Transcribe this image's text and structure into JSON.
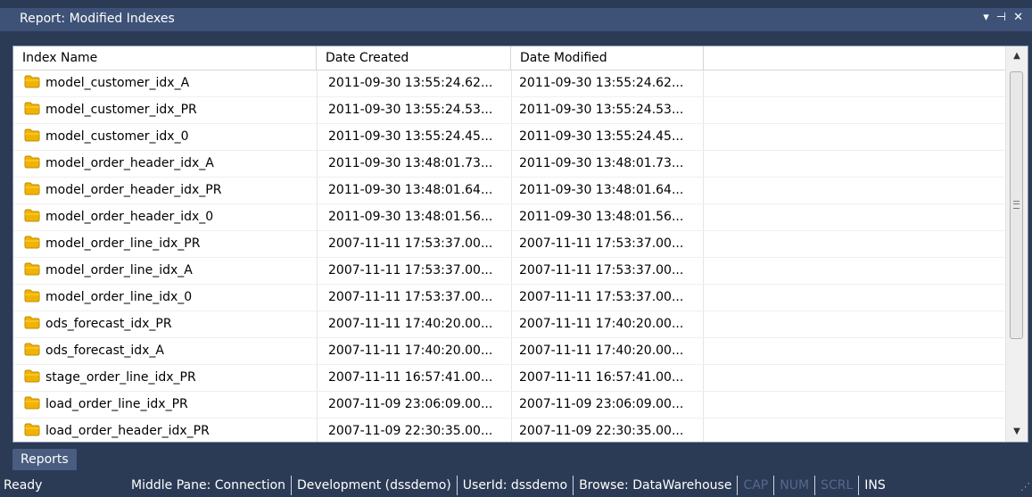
{
  "panel": {
    "title": "Report: Modified Indexes",
    "pin_icon": "pin-icon",
    "dropdown_icon": "chevron-down-icon",
    "close_icon": "close-icon"
  },
  "grid": {
    "columns": [
      "Index Name",
      "Date Created",
      "Date Modified"
    ],
    "row_icon": "folder-icon",
    "rows": [
      {
        "name": "model_customer_idx_A",
        "created": "2011-09-30 13:55:24.62...",
        "modified": "2011-09-30 13:55:24.62..."
      },
      {
        "name": "model_customer_idx_PR",
        "created": "2011-09-30 13:55:24.53...",
        "modified": "2011-09-30 13:55:24.53..."
      },
      {
        "name": "model_customer_idx_0",
        "created": "2011-09-30 13:55:24.45...",
        "modified": "2011-09-30 13:55:24.45..."
      },
      {
        "name": "model_order_header_idx_A",
        "created": "2011-09-30 13:48:01.73...",
        "modified": "2011-09-30 13:48:01.73..."
      },
      {
        "name": "model_order_header_idx_PR",
        "created": "2011-09-30 13:48:01.64...",
        "modified": "2011-09-30 13:48:01.64..."
      },
      {
        "name": "model_order_header_idx_0",
        "created": "2011-09-30 13:48:01.56...",
        "modified": "2011-09-30 13:48:01.56..."
      },
      {
        "name": "model_order_line_idx_PR",
        "created": "2007-11-11 17:53:37.00...",
        "modified": "2007-11-11 17:53:37.00..."
      },
      {
        "name": "model_order_line_idx_A",
        "created": "2007-11-11 17:53:37.00...",
        "modified": "2007-11-11 17:53:37.00..."
      },
      {
        "name": "model_order_line_idx_0",
        "created": "2007-11-11 17:53:37.00...",
        "modified": "2007-11-11 17:53:37.00..."
      },
      {
        "name": "ods_forecast_idx_PR",
        "created": "2007-11-11 17:40:20.00...",
        "modified": "2007-11-11 17:40:20.00..."
      },
      {
        "name": "ods_forecast_idx_A",
        "created": "2007-11-11 17:40:20.00...",
        "modified": "2007-11-11 17:40:20.00..."
      },
      {
        "name": "stage_order_line_idx_PR",
        "created": "2007-11-11 16:57:41.00...",
        "modified": "2007-11-11 16:57:41.00..."
      },
      {
        "name": "load_order_line_idx_PR",
        "created": "2007-11-09 23:06:09.00...",
        "modified": "2007-11-09 23:06:09.00..."
      },
      {
        "name": "load_order_header_idx_PR",
        "created": "2007-11-09 22:30:35.00...",
        "modified": "2007-11-09 22:30:35.00..."
      }
    ]
  },
  "tabs": [
    "Reports"
  ],
  "status": {
    "ready": "Ready",
    "segments": [
      {
        "text": "Middle Pane: Connection",
        "active": true
      },
      {
        "text": "Development (dssdemo)",
        "active": true
      },
      {
        "text": "UserId: dssdemo",
        "active": true
      },
      {
        "text": "Browse: DataWarehouse",
        "active": true
      },
      {
        "text": "CAP",
        "active": false
      },
      {
        "text": "NUM",
        "active": false
      },
      {
        "text": "SCRL",
        "active": false
      },
      {
        "text": "INS",
        "active": true
      }
    ]
  },
  "colors": {
    "background": "#2b3a55",
    "title_bar": "#3e5277",
    "folder": "#f0b400"
  }
}
